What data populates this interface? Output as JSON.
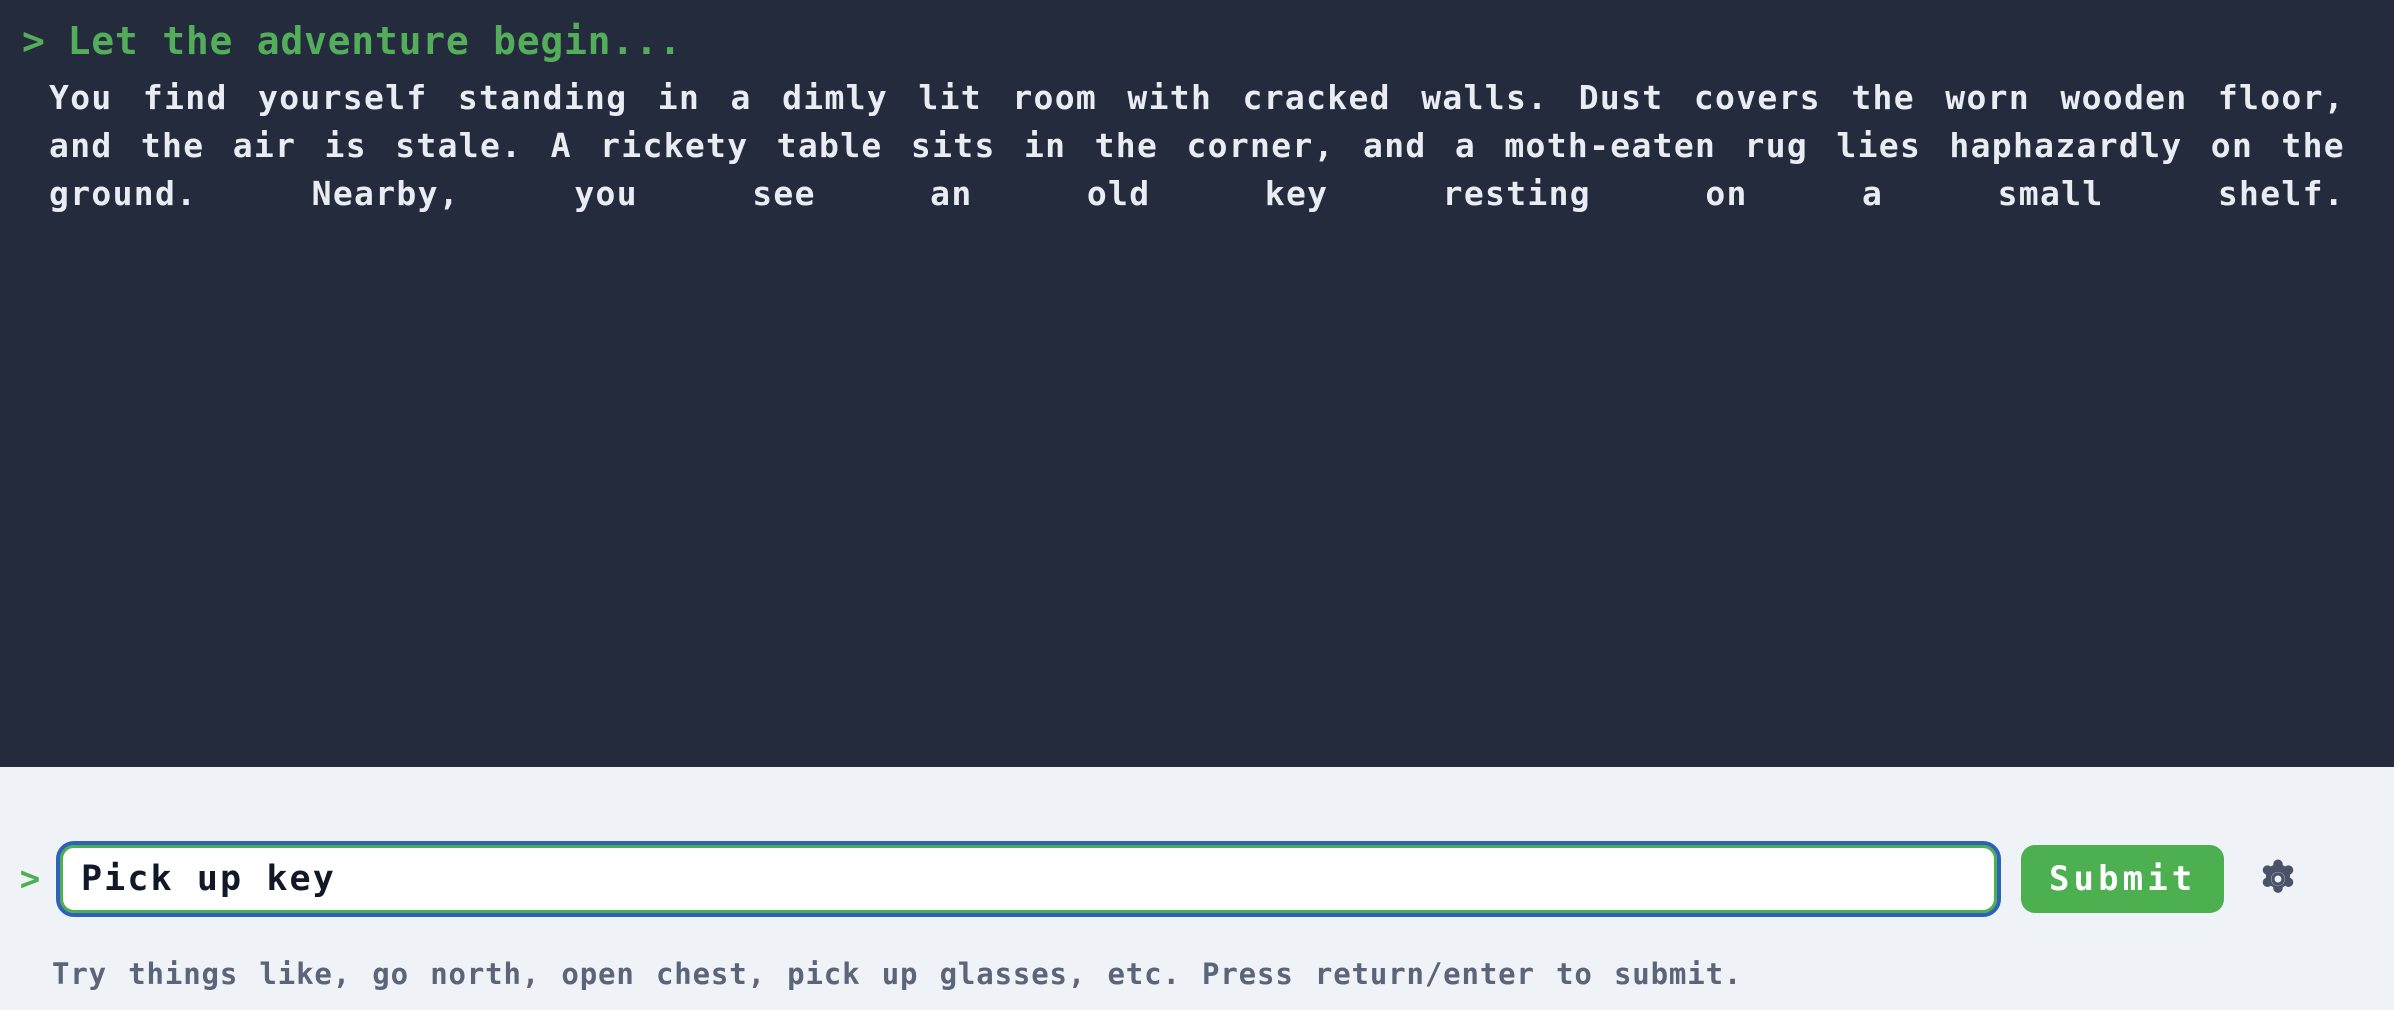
{
  "theme": {
    "transcript_bg": "#242b3d",
    "footer_bg": "#eff2f7",
    "prompt_green": "#54ad5a",
    "story_text": "#e9ecf2",
    "accent_green": "#4caf50",
    "focus_blue": "#2d62b8",
    "hint_gray": "#5b6478",
    "gear_gray": "#4a5268"
  },
  "transcript": {
    "prompt_chevron": ">",
    "prompt_line": "Let the adventure begin...",
    "story": "You find yourself standing in a dimly lit room with cracked walls. Dust covers the worn wooden floor, and the air is stale. A rickety table sits in the corner, and a moth-eaten rug lies haphazardly on the ground. Nearby, you see an old key resting on a small shelf."
  },
  "footer": {
    "input_chevron": ">",
    "command_value": "Pick up key",
    "command_placeholder": "",
    "submit_label": "Submit",
    "settings_icon": "gear-icon",
    "hint": "Try things like, go north, open chest, pick up glasses, etc. Press return/enter to submit."
  }
}
